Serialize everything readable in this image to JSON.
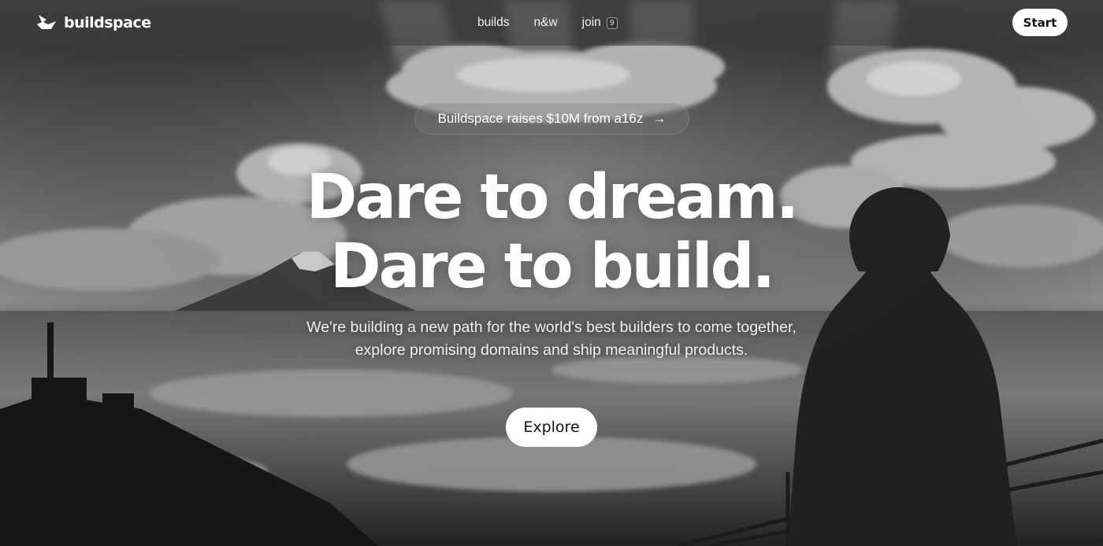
{
  "brand": {
    "name": "buildspace",
    "icon": "buildspace-logo-icon"
  },
  "nav": {
    "builds": "builds",
    "nw": "n&w",
    "join": "join",
    "join_badge": "9"
  },
  "header": {
    "start_label": "Start"
  },
  "announcement": {
    "text": "Buildspace raises $10M from a16z",
    "arrow": "→"
  },
  "hero": {
    "headline_line1": "Dare to dream.",
    "headline_line2": "Dare to build.",
    "subtext_line1": "We're building a new path for the world's best builders to come together,",
    "subtext_line2": "explore promising domains and ship meaningful products.",
    "explore_label": "Explore"
  },
  "colors": {
    "background": "#1a1a1a",
    "button": "#ffffff",
    "button_text": "#111111",
    "text": "#ffffff"
  }
}
